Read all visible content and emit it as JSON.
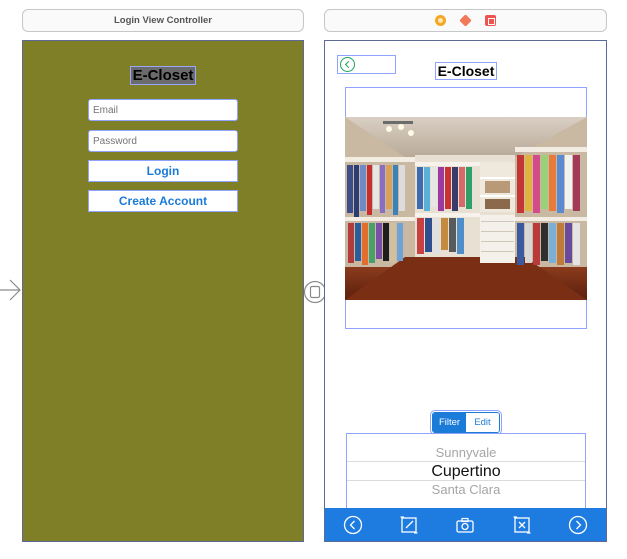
{
  "left_scene": {
    "header_title": "Login View Controller",
    "title": "E-Closet",
    "email_placeholder": "Email",
    "password_placeholder": "Password",
    "login_label": "Login",
    "create_account_label": "Create Account",
    "background_color": "#7f7f27"
  },
  "right_scene": {
    "header_icons": [
      "view-controller-icon",
      "first-responder-icon",
      "exit-icon"
    ],
    "title": "E-Closet",
    "image": "closet-photo",
    "segmented": {
      "items": [
        "Filter",
        "Edit"
      ],
      "selected": "Filter"
    },
    "picker": {
      "rows": [
        "Sunnyvale",
        "Cupertino",
        "Santa Clara"
      ],
      "selected": "Cupertino"
    },
    "toolbar_icons": [
      "back-circle-icon",
      "compose-icon",
      "camera-icon",
      "trash-icon",
      "forward-circle-icon"
    ],
    "accent_color": "#1e7be0"
  }
}
